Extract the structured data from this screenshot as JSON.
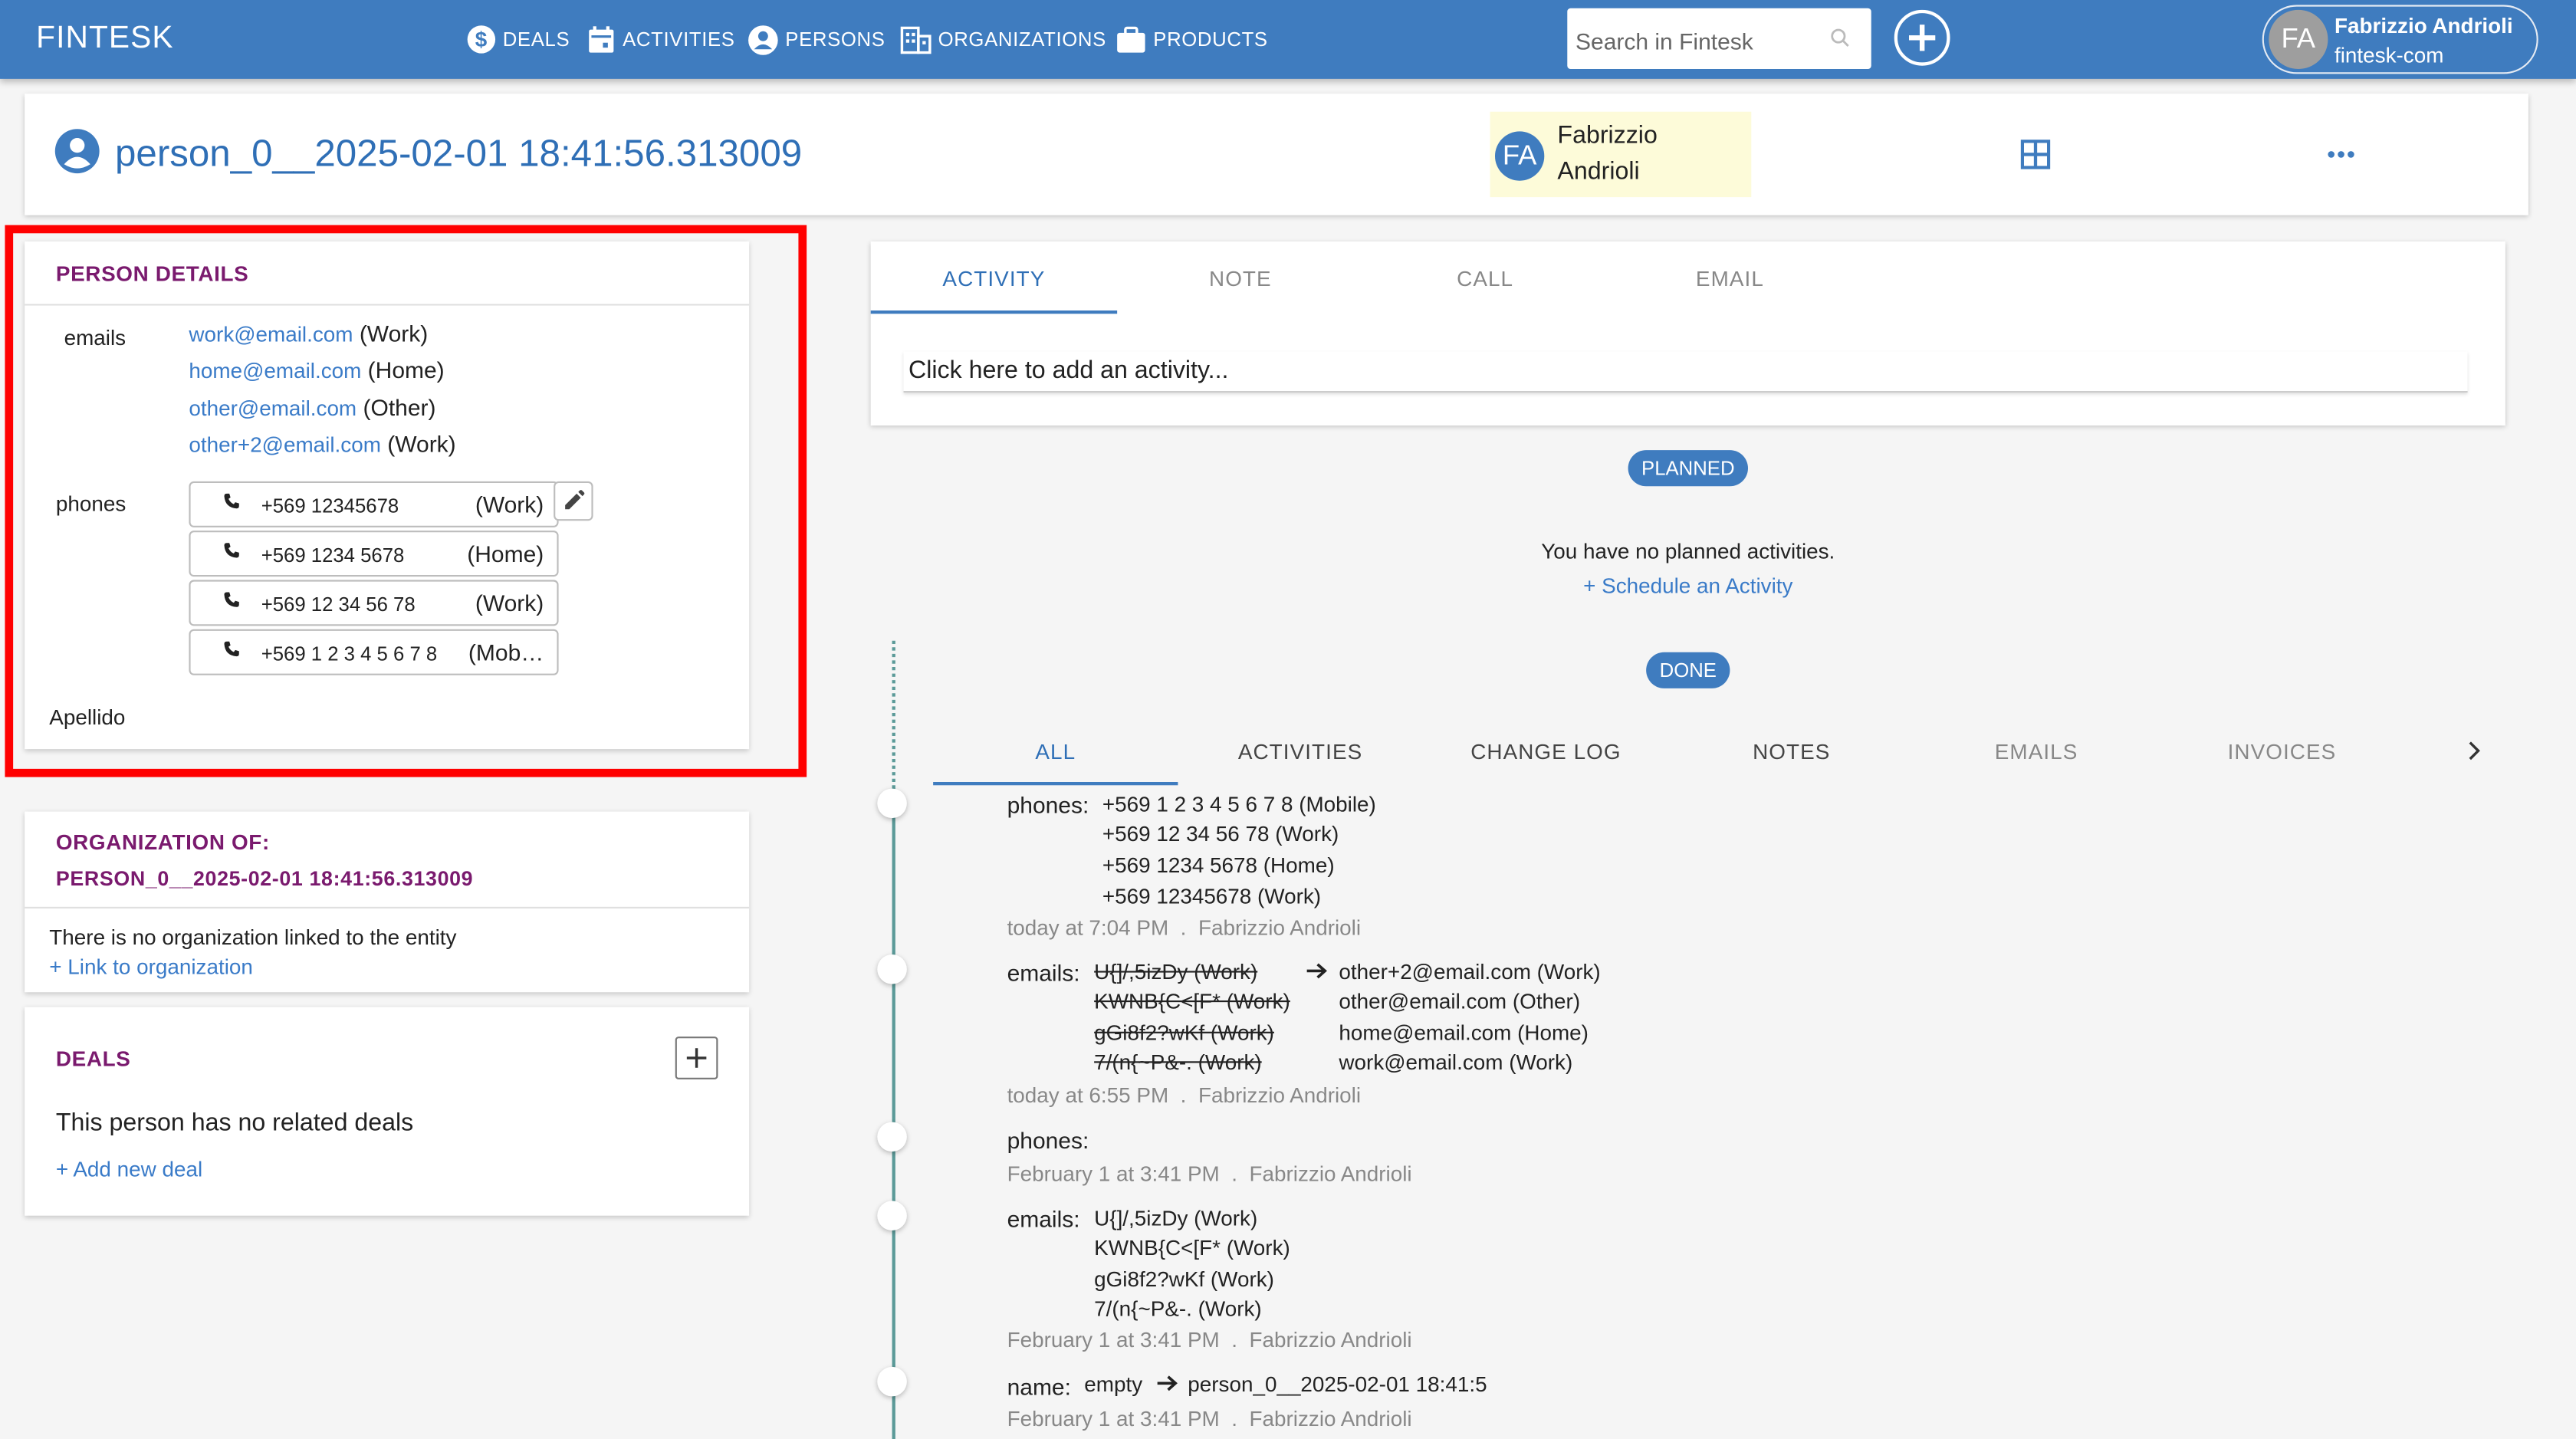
{
  "app": {
    "brand": "FINTESK",
    "nav": [
      "DEALS",
      "ACTIVITIES",
      "PERSONS",
      "ORGANIZATIONS",
      "PRODUCTS"
    ],
    "search_placeholder": "Search in Fintesk",
    "user": {
      "initials": "FA",
      "name": "Fabrizzio Andrioli",
      "org": "fintesk-com"
    }
  },
  "header": {
    "title": "person_0__2025-02-01 18:41:56.313009",
    "owner": {
      "initials": "FA",
      "first": "Fabrizzio",
      "last": "Andrioli"
    }
  },
  "person_details": {
    "title": "PERSON DETAILS",
    "emails_label": "emails",
    "emails": [
      {
        "address": "work@email.com",
        "type": "(Work)"
      },
      {
        "address": "home@email.com",
        "type": "(Home)"
      },
      {
        "address": "other@email.com",
        "type": "(Other)"
      },
      {
        "address": "other+2@email.com",
        "type": "(Work)"
      }
    ],
    "phones_label": "phones",
    "phones": [
      {
        "number": "+569 12345678",
        "type": "(Work)"
      },
      {
        "number": "+569 1234 5678",
        "type": "(Home)"
      },
      {
        "number": "+569 12 34 56 78",
        "type": "(Work)"
      },
      {
        "number": "+569 1 2 3 4 5 6 7 8",
        "type": "(Mob…"
      }
    ],
    "apellido_label": "Apellido"
  },
  "organization": {
    "title_line1": "ORGANIZATION OF:",
    "title_line2": "PERSON_0__2025-02-01 18:41:56.313009",
    "empty_text": "There is no organization linked to the entity",
    "link_text": "+ Link to organization"
  },
  "deals": {
    "title": "DEALS",
    "empty_text": "This person has no related deals",
    "add_text": "+ Add new deal"
  },
  "compose": {
    "tabs": [
      "ACTIVITY",
      "NOTE",
      "CALL",
      "EMAIL"
    ],
    "placeholder": "Click here to add an activity..."
  },
  "planned": {
    "badge": "PLANNED",
    "empty_text": "You have no planned activities.",
    "schedule_text": "+ Schedule an Activity"
  },
  "done": {
    "badge": "DONE",
    "tabs": [
      "ALL",
      "ACTIVITIES",
      "CHANGE LOG",
      "NOTES",
      "EMAILS",
      "INVOICES"
    ]
  },
  "timeline": [
    {
      "key": "phones:",
      "lines": [
        "+569 1 2 3 4 5 6 7 8 (Mobile)",
        "+569 12 34 56 78 (Work)",
        "+569 1234 5678 (Home)",
        "+569 12345678 (Work)"
      ],
      "meta_time": "today at 7:04 PM",
      "meta_user": "Fabrizzio Andrioli"
    },
    {
      "key": "emails:",
      "old": [
        "U{]/,5izDy (Work)",
        "KWNB{C<[F* (Work)",
        "gGi8f2?wKf (Work)",
        "7/(n{~P&-. (Work)"
      ],
      "new": [
        "other+2@email.com (Work)",
        "other@email.com (Other)",
        "home@email.com (Home)",
        "work@email.com (Work)"
      ],
      "meta_time": "today at 6:55 PM",
      "meta_user": "Fabrizzio Andrioli"
    },
    {
      "key": "phones:",
      "meta_time": "February 1 at 3:41 PM",
      "meta_user": "Fabrizzio Andrioli"
    },
    {
      "key": "emails:",
      "lines": [
        "U{]/,5izDy (Work)",
        "KWNB{C<[F* (Work)",
        "gGi8f2?wKf (Work)",
        "7/(n{~P&-. (Work)"
      ],
      "meta_time": "February 1 at 3:41 PM",
      "meta_user": "Fabrizzio Andrioli"
    },
    {
      "key": "name:",
      "old_value": "empty",
      "new_value": "person_0__2025-02-01 18:41:5",
      "meta_time": "February 1 at 3:41 PM",
      "meta_user": "Fabrizzio Andrioli"
    }
  ],
  "meta_separator": "."
}
